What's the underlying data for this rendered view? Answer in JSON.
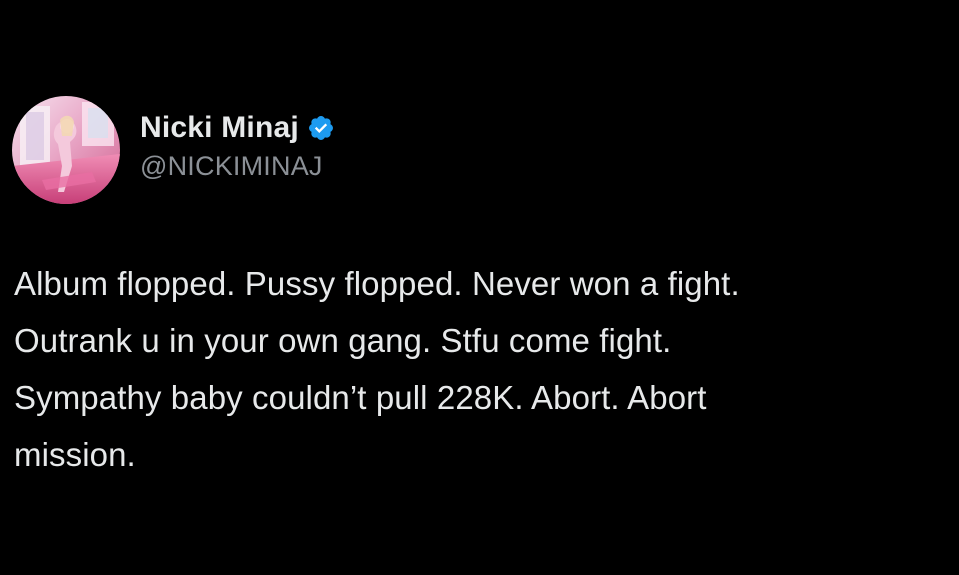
{
  "tweet": {
    "author": {
      "display_name": "Nicki Minaj",
      "handle": "@NICKIMINAJ",
      "verified": true,
      "verified_icon": "verified-badge-icon"
    },
    "text_lines": [
      "Album flopped. Pussy flopped. Never won a fight.",
      "Outrank u in your own gang. Stfu come fight.",
      "Sympathy baby couldn’t pull 228K. Abort. Abort",
      "mission."
    ]
  },
  "colors": {
    "background": "#000000",
    "text_primary": "#e7e9ea",
    "text_secondary": "#8b9096",
    "verified_blue": "#1d9bf0"
  }
}
